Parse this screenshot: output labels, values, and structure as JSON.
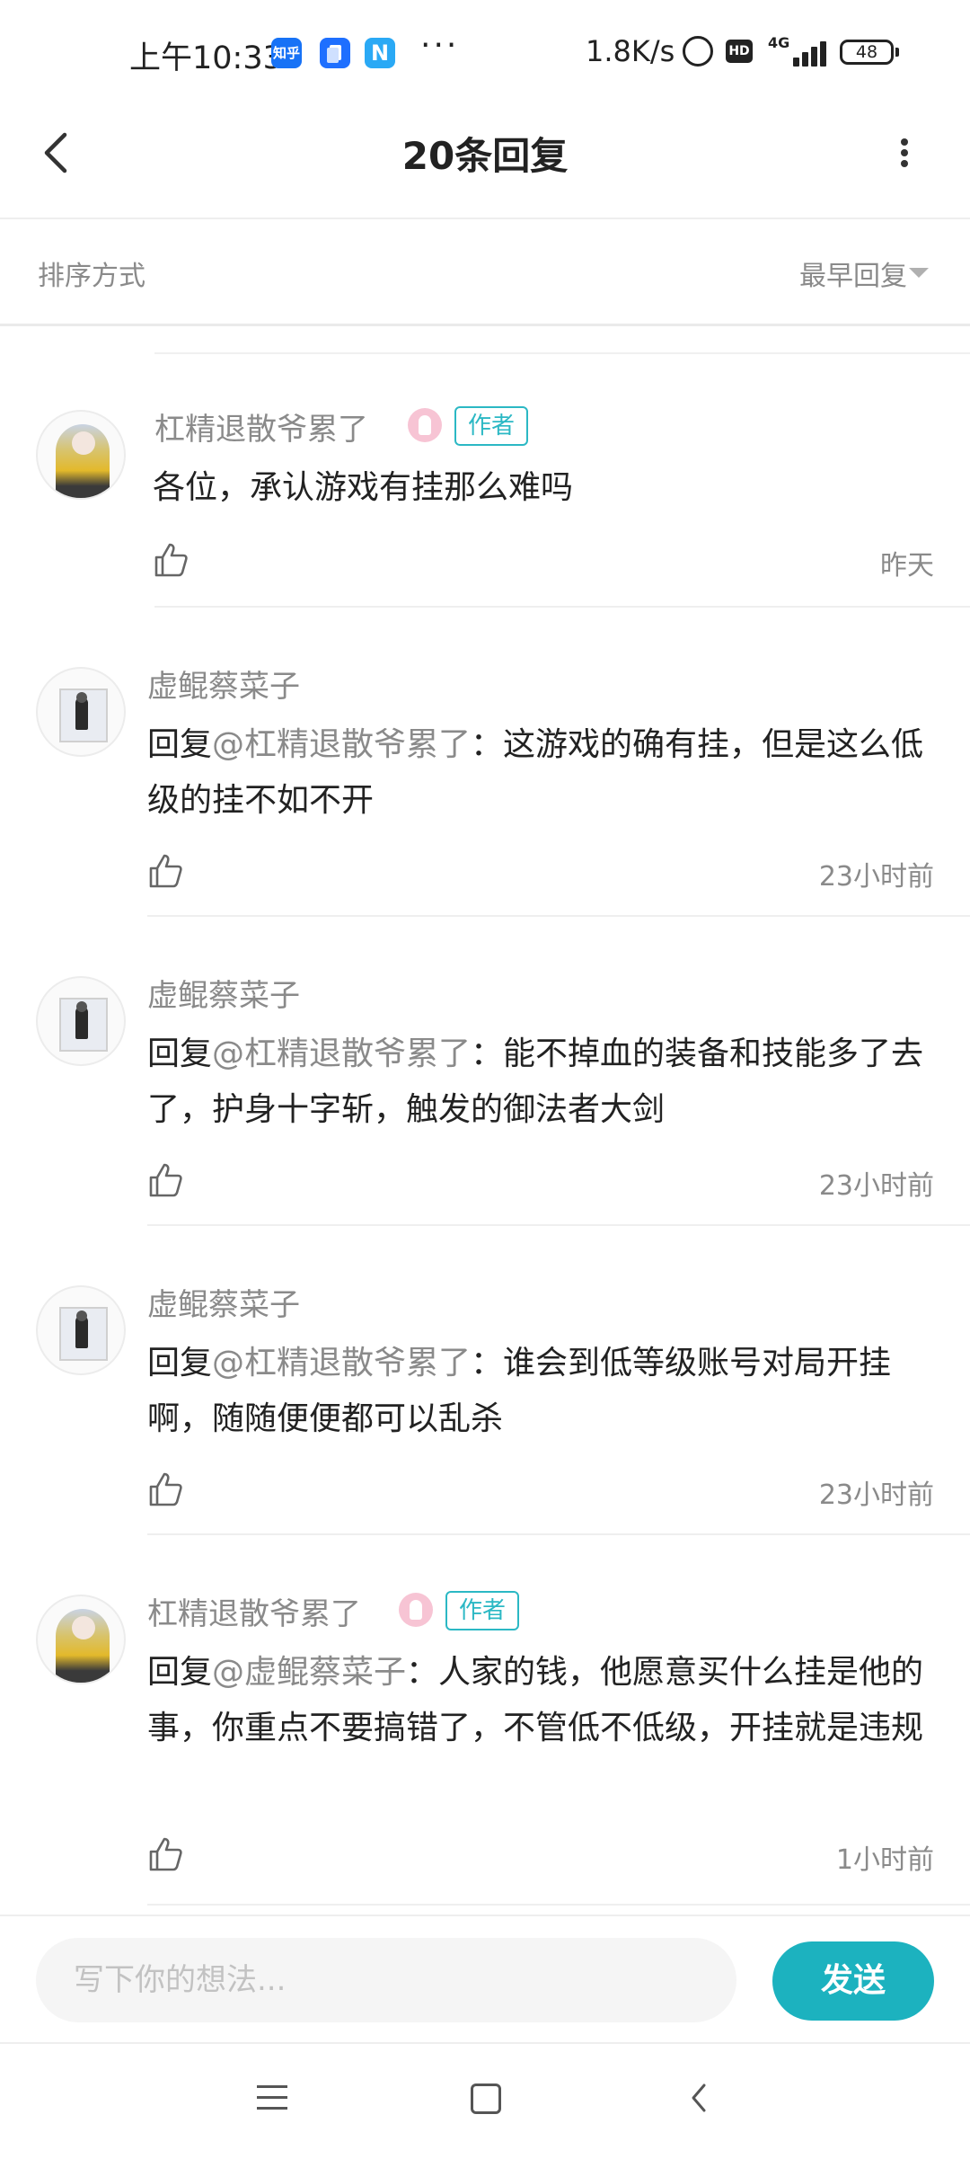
{
  "status_bar": {
    "time": "上午10:33",
    "app_icons": [
      {
        "name": "zhihu-icon",
        "label": "知乎",
        "color": "#1772f6"
      },
      {
        "name": "notes-icon",
        "label": "",
        "color": "#1e6fff"
      },
      {
        "name": "n-app-icon",
        "label": "N",
        "color": "#2aa9f5"
      }
    ],
    "more": "···",
    "speed": "1.8K/s",
    "network": "4G",
    "hd": "HD",
    "battery": "48"
  },
  "header": {
    "title": "20条回复"
  },
  "sort": {
    "label": "排序方式",
    "value": "最早回复"
  },
  "comments": [
    {
      "user": "杠精退散爷累了",
      "is_author": true,
      "author_badge": "作者",
      "reply_prefix": "",
      "mention": "",
      "text": "各位，承认游戏有挂那么难吗",
      "time": "昨天"
    },
    {
      "user": "虚鲲蔡菜子",
      "is_author": false,
      "reply_prefix": "回复",
      "mention": "@杠精退散爷累了",
      "text": "：这游戏的确有挂，但是这么低级的挂不如不开",
      "time": "23小时前"
    },
    {
      "user": "虚鲲蔡菜子",
      "is_author": false,
      "reply_prefix": "回复",
      "mention": "@杠精退散爷累了",
      "text": "：能不掉血的装备和技能多了去了，护身十字斩，触发的御法者大剑",
      "time": "23小时前"
    },
    {
      "user": "虚鲲蔡菜子",
      "is_author": false,
      "reply_prefix": "回复",
      "mention": "@杠精退散爷累了",
      "text": "：谁会到低等级账号对局开挂啊，随随便便都可以乱杀",
      "time": "23小时前"
    },
    {
      "user": "杠精退散爷累了",
      "is_author": true,
      "author_badge": "作者",
      "reply_prefix": "回复",
      "mention": "@虚鲲蔡菜子",
      "text": "：人家的钱，他愿意买什么挂是他的事，你重点不要搞错了，不管低不低级，开挂就是违规",
      "time": "1小时前"
    }
  ],
  "input": {
    "placeholder": "写下你的想法...",
    "send_label": "发送"
  },
  "colors": {
    "accent": "#1cb2bf",
    "muted_text": "#8a8a8a"
  }
}
